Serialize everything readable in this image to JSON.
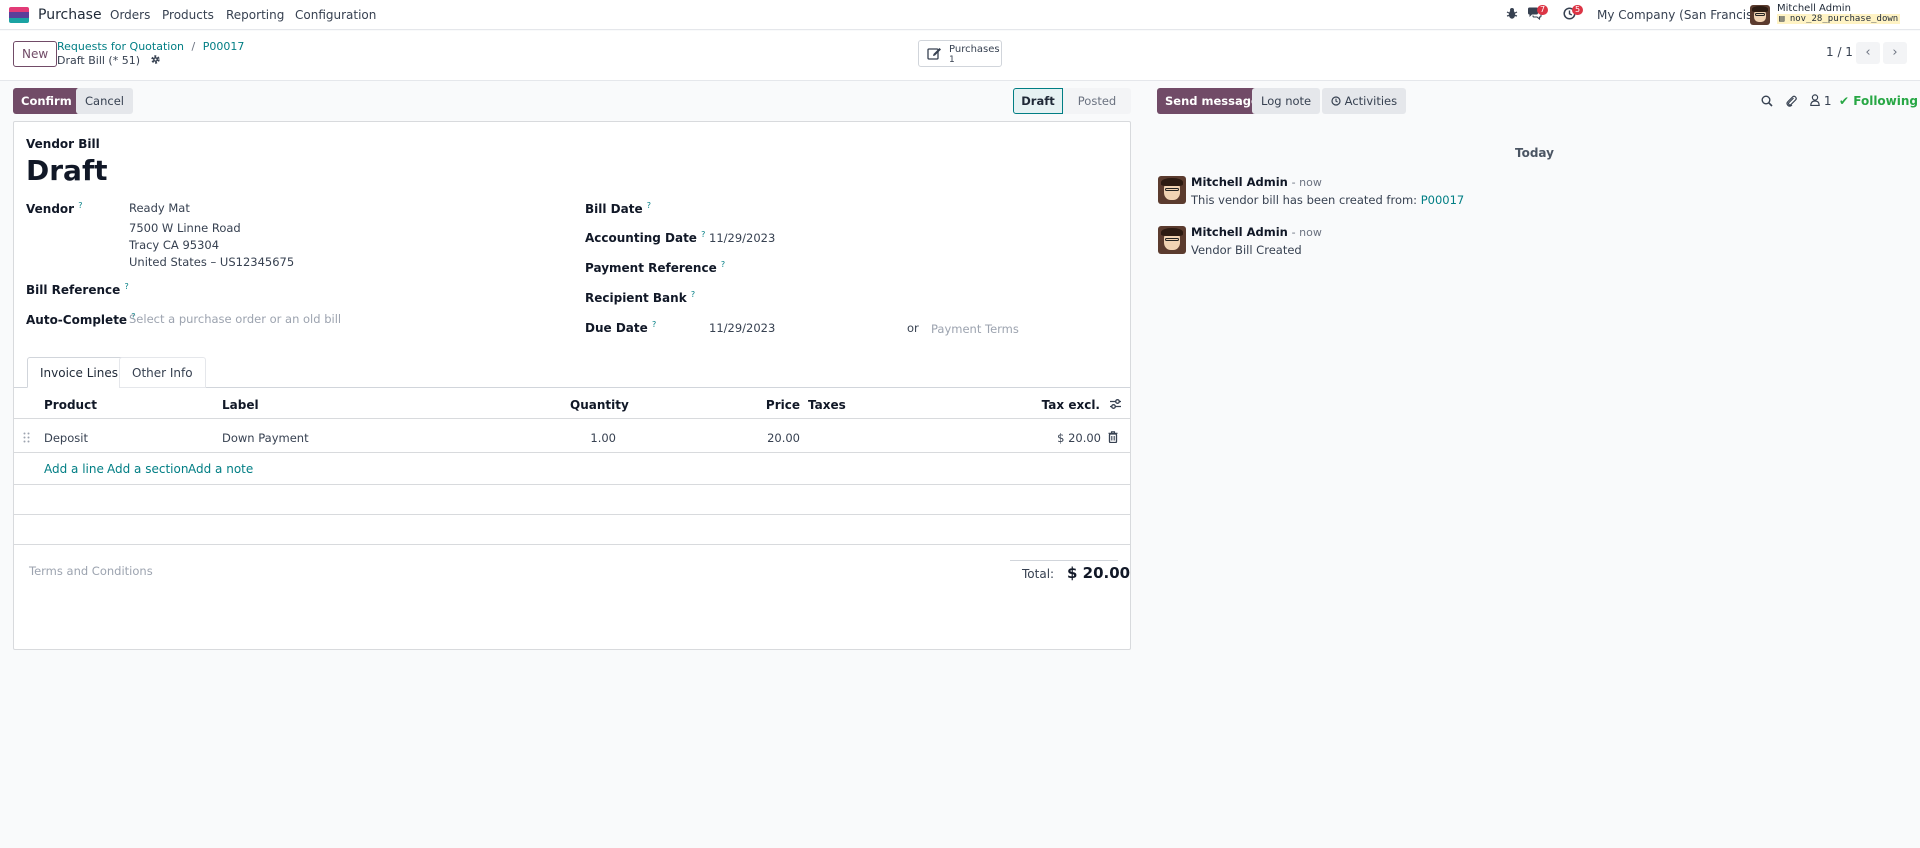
{
  "navbar": {
    "app_name": "Purchase",
    "menu": [
      "Orders",
      "Products",
      "Reporting",
      "Configuration"
    ],
    "messages_count": "7",
    "activities_count": "5",
    "company": "My Company (San Francisco)",
    "user_name": "Mitchell Admin",
    "database": "nov_28_purchase_down"
  },
  "control": {
    "new_label": "New",
    "breadcrumb_parent": "Requests for Quotation",
    "breadcrumb_sep": "/",
    "breadcrumb_current": "P00017",
    "record_sub": "Draft Bill (* 51)",
    "smart_button_label": "Purchases",
    "smart_button_count": "1",
    "pager": "1 / 1"
  },
  "actions": {
    "confirm": "Confirm",
    "cancel": "Cancel",
    "status_draft": "Draft",
    "status_posted": "Posted"
  },
  "form": {
    "doc_type": "Vendor Bill",
    "doc_name": "Draft",
    "vendor_label": "Vendor",
    "vendor_name": "Ready Mat",
    "vendor_street": "7500 W Linne Road",
    "vendor_city": "Tracy CA 95304",
    "vendor_country": "United States – US12345675",
    "bill_ref_label": "Bill Reference",
    "auto_complete_label": "Auto-Complete",
    "auto_complete_placeholder": "Select a purchase order or an old bill",
    "bill_date_label": "Bill Date",
    "accounting_date_label": "Accounting Date",
    "accounting_date": "11/29/2023",
    "payment_ref_label": "Payment Reference",
    "recipient_bank_label": "Recipient Bank",
    "due_date_label": "Due Date",
    "due_date": "11/29/2023",
    "or_text": "or",
    "payment_terms_placeholder": "Payment Terms",
    "help_mark": "?"
  },
  "tabs": {
    "invoice_lines": "Invoice Lines",
    "other_info": "Other Info"
  },
  "table": {
    "headers": {
      "product": "Product",
      "label": "Label",
      "quantity": "Quantity",
      "price": "Price",
      "taxes": "Taxes",
      "tax_excl": "Tax excl."
    },
    "rows": [
      {
        "product": "Deposit",
        "label": "Down Payment",
        "quantity": "1.00",
        "price": "20.00",
        "taxes": "",
        "subtotal": "$ 20.00"
      }
    ],
    "add_line": "Add a line",
    "add_section": "Add a section",
    "add_note": "Add a note"
  },
  "footer": {
    "terms_placeholder": "Terms and Conditions",
    "total_label": "Total:",
    "total_value": "$ 20.00"
  },
  "chatter": {
    "send_message": "Send message",
    "log_note": "Log note",
    "activities": "Activities",
    "followers_count": "1",
    "following": "Following",
    "date_separator": "Today",
    "messages": [
      {
        "author": "Mitchell Admin",
        "time": "- now",
        "body": "This vendor bill has been created from:",
        "link": "P00017"
      },
      {
        "author": "Mitchell Admin",
        "time": "- now",
        "body": "Vendor Bill Created"
      }
    ]
  },
  "colors": {
    "brand": "#714b67",
    "link": "#017e84",
    "following": "#28a745",
    "badge": "#dc3545"
  }
}
